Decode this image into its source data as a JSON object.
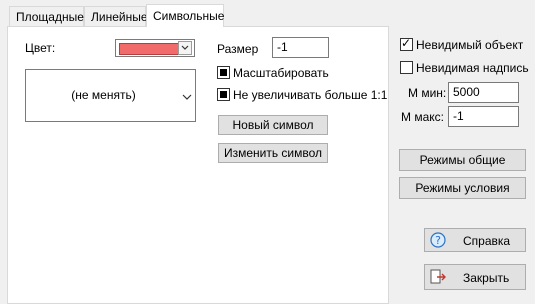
{
  "tabs": [
    {
      "label": "Площадные"
    },
    {
      "label": "Линейные"
    },
    {
      "label": "Символьные"
    }
  ],
  "left": {
    "color_label": "Цвет:",
    "color_swatch": "#f26b6b",
    "dropdown_value": "(не менять)",
    "size_label": "Размер",
    "size_value": "-1",
    "scale_label": "Масштабировать",
    "noenlarge_label": "Не увеличивать больше 1:1",
    "new_symbol": "Новый символ",
    "change_symbol": "Изменить символ"
  },
  "right": {
    "invisible_object": "Невидимый объект",
    "invisible_label": "Невидимая надпись",
    "m_min_label": "М мин:",
    "m_min_value": "5000",
    "m_max_label": "М макс:",
    "m_max_value": "-1",
    "modes_general": "Режимы общие",
    "modes_condition": "Режимы условия",
    "help": "Справка",
    "close": "Закрыть"
  }
}
